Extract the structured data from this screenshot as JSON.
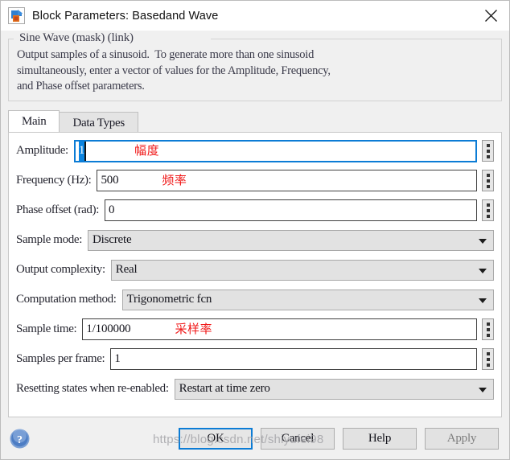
{
  "window": {
    "title": "Block Parameters: Basedand Wave",
    "icon": "simulink-block-icon",
    "close_icon": "close-icon"
  },
  "description": {
    "group_title": "Sine Wave (mask) (link)",
    "text": "Output samples of a sinusoid.  To generate more than one sinusoid\nsimultaneously, enter a vector of values for the Amplitude, Frequency,\nand Phase offset parameters."
  },
  "tabs": [
    {
      "label": "Main",
      "active": true
    },
    {
      "label": "Data Types",
      "active": false
    }
  ],
  "fields": {
    "amplitude": {
      "label": "Amplitude:",
      "value": "1",
      "annotation": "幅度",
      "selected": true,
      "focused": true
    },
    "frequency": {
      "label": "Frequency (Hz):",
      "value": "500",
      "annotation": "频率"
    },
    "phase_offset": {
      "label": "Phase offset (rad):",
      "value": "0"
    },
    "sample_mode": {
      "label": "Sample mode:",
      "value": "Discrete"
    },
    "output_complexity": {
      "label": "Output complexity:",
      "value": "Real"
    },
    "computation_method": {
      "label": "Computation method:",
      "value": "Trigonometric fcn"
    },
    "sample_time": {
      "label": "Sample time:",
      "value": "1/100000",
      "annotation": "采样率"
    },
    "samples_per_frame": {
      "label": "Samples per frame:",
      "value": "1"
    },
    "resetting_states": {
      "label": "Resetting states when re-enabled:",
      "value": "Restart at time zero"
    }
  },
  "footer": {
    "help_icon": "help-question-icon",
    "buttons": {
      "ok": "OK",
      "cancel": "Cancel",
      "help": "Help",
      "apply": "Apply"
    }
  },
  "watermark": {
    "text": "https://blog.csdn.net/shiyufei98"
  },
  "colors": {
    "focus_blue": "#0c7cd5",
    "selection_blue": "#0a84e0",
    "annotation_red": "#f01818",
    "dialog_bg": "#f0f0f0"
  }
}
